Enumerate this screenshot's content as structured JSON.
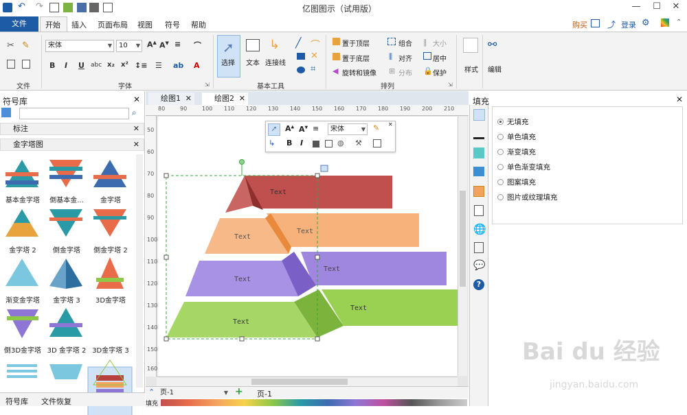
{
  "window": {
    "title": "亿图图示（试用版）"
  },
  "menu": {
    "file": "文件",
    "tabs": [
      "开始",
      "插入",
      "页面布局",
      "视图",
      "符号",
      "帮助"
    ],
    "right": {
      "buy": "购买",
      "login": "登录"
    }
  },
  "ribbon": {
    "font_name": "宋体",
    "font_size": "10",
    "groups": {
      "file": "文件",
      "font": "字体",
      "basic_tools": "基本工具",
      "arrange": "排列"
    },
    "tools": {
      "select": "选择",
      "text": "文本",
      "connector": "连接线"
    },
    "arrange": {
      "bring_top": "置于顶层",
      "send_bottom": "置于底层",
      "rotate": "旋转和镜像",
      "group": "组合",
      "align": "对齐",
      "distribute": "分布",
      "size": "大小",
      "center": "居中",
      "protect": "保护"
    },
    "style": "样式",
    "edit": "编辑"
  },
  "symbol_library": {
    "title": "符号库",
    "categories": [
      "标注",
      "金字塔图"
    ],
    "shapes": [
      "基本金字塔",
      "倒基本金...",
      "金字塔",
      "金字塔 2",
      "倒金字塔",
      "倒金字塔 2",
      "渐变金字塔",
      "金字塔 3",
      "3D金字塔",
      "倒3D金字塔",
      "3D 金字塔 2",
      "3D金字塔 3"
    ],
    "bottom_tabs": [
      "符号库",
      "文件恢复"
    ]
  },
  "doc_tabs": [
    "绘图1",
    "绘图2"
  ],
  "ruler": {
    "h": [
      "80",
      "90",
      "100",
      "110",
      "120",
      "130",
      "140",
      "150",
      "160",
      "170",
      "180",
      "190",
      "200",
      "210"
    ],
    "v": [
      "50",
      "60",
      "70",
      "80",
      "90",
      "100",
      "110",
      "120",
      "130",
      "140",
      "150",
      "160"
    ]
  },
  "diagram": {
    "levels": [
      {
        "label": "Text",
        "side_label": "Text",
        "color": "#b5403e",
        "side_color": "#c0504d"
      },
      {
        "label": "Text",
        "side_label": "Text",
        "color": "#f4a35f",
        "side_color": "#f6b27a"
      },
      {
        "label": "Text",
        "side_label": "Text",
        "color": "#8e76d6",
        "side_color": "#9f86df"
      },
      {
        "label": "Text",
        "side_label": "Text",
        "color": "#8fc847",
        "side_color": "#9bd152"
      }
    ]
  },
  "float_toolbar": {
    "font": "宋体"
  },
  "status": {
    "page_select": "页-1",
    "page_tab": "页-1",
    "fill_label": "填充"
  },
  "fill_panel": {
    "title": "填充",
    "options": [
      "无填充",
      "单色填充",
      "渐变填充",
      "单色渐变填充",
      "图案填充",
      "图片或纹理填充"
    ],
    "selected": 0
  },
  "watermark": {
    "brand": "Bai du 经验",
    "url": "jingyan.baidu.com"
  }
}
